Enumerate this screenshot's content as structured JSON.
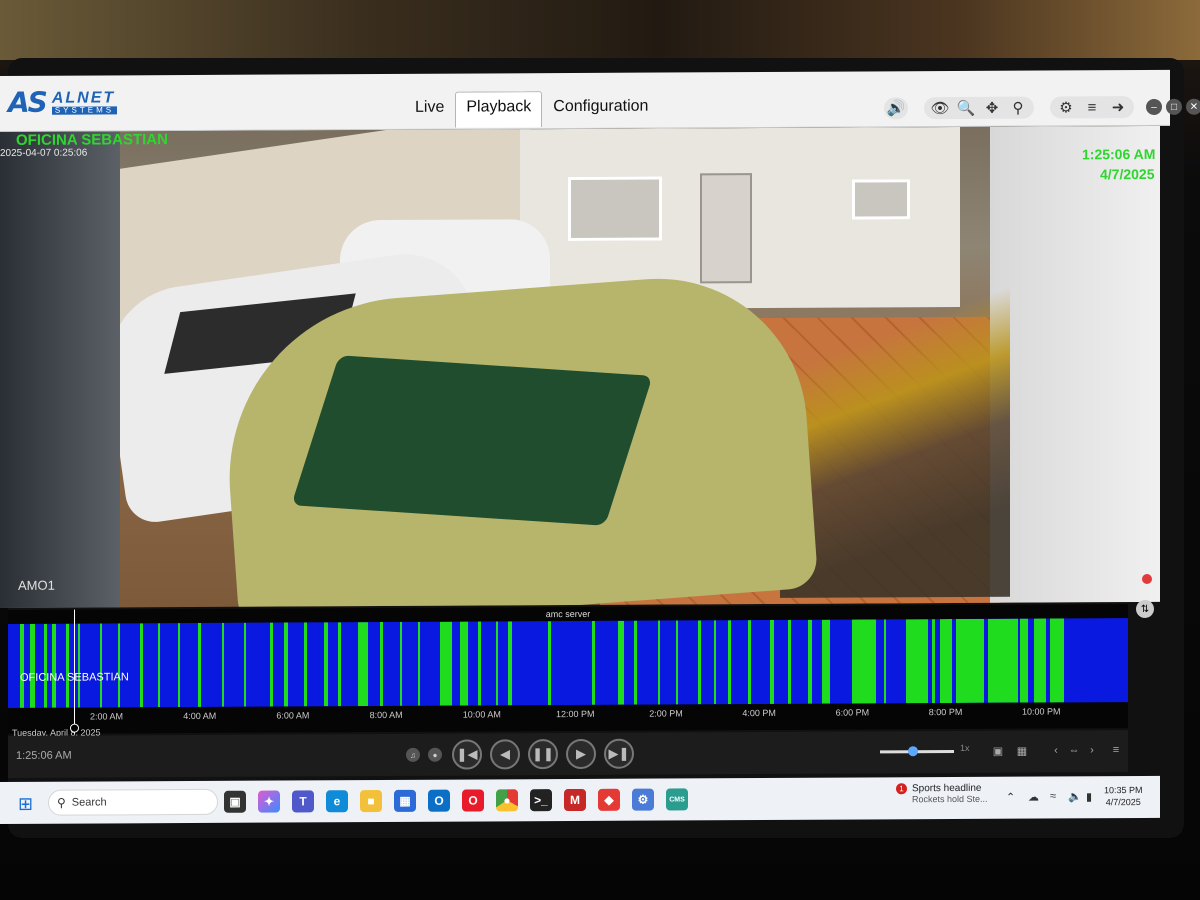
{
  "app": {
    "brand_mark": "AS",
    "brand_name": "ALNET",
    "brand_sub": "SYSTEMS",
    "tabs": [
      {
        "label": "Live",
        "active": false
      },
      {
        "label": "Playback",
        "active": true
      },
      {
        "label": "Configuration",
        "active": false
      }
    ],
    "toolbar_icons": [
      "volume-icon",
      "eye-icon",
      "zoom-in-icon",
      "move-icon",
      "search-icon",
      "pin-icon",
      "menu-icon",
      "logout-icon"
    ],
    "window_buttons": [
      "minimize-icon",
      "restore-icon",
      "close-icon"
    ]
  },
  "camera": {
    "title": "OFICINA SEBASTIAN",
    "osd_date_ghost": "2025-04-07  0:25:06",
    "osd_time": "1:25:06 AM",
    "osd_date": "4/7/2025",
    "channel_label": "AMO1",
    "recording": true
  },
  "timeline": {
    "server": "amc server",
    "channel": "OFICINA SEBASTIAN",
    "date_label": "Tuesday, April 8, 2025",
    "tick_labels": [
      "2:00 AM",
      "4:00 AM",
      "6:00 AM",
      "8:00 AM",
      "10:00 AM",
      "12:00 PM",
      "2:00 PM",
      "4:00 PM",
      "6:00 PM",
      "8:00 PM",
      "10:00 PM"
    ],
    "colors": {
      "continuous": "#0a19e0",
      "motion": "#1fdc1f"
    }
  },
  "playback": {
    "current_time": "1:25:06 AM",
    "speed_label": "1x",
    "speed_value": 0.45
  },
  "taskbar": {
    "search_placeholder": "Search",
    "apps": [
      "task-view-icon",
      "copilot-icon",
      "teams-icon",
      "edge-icon",
      "file-explorer-icon",
      "store-icon",
      "outlook-icon",
      "opera-icon",
      "chrome-icon",
      "terminal-icon",
      "mcafee-icon",
      "anydesk-icon",
      "settings-icon",
      "cms-icon"
    ],
    "news_title": "Sports headline",
    "news_sub": "Rockets hold Ste...",
    "news_badge": "1",
    "clock_time": "10:35 PM",
    "clock_date": "4/7/2025"
  }
}
